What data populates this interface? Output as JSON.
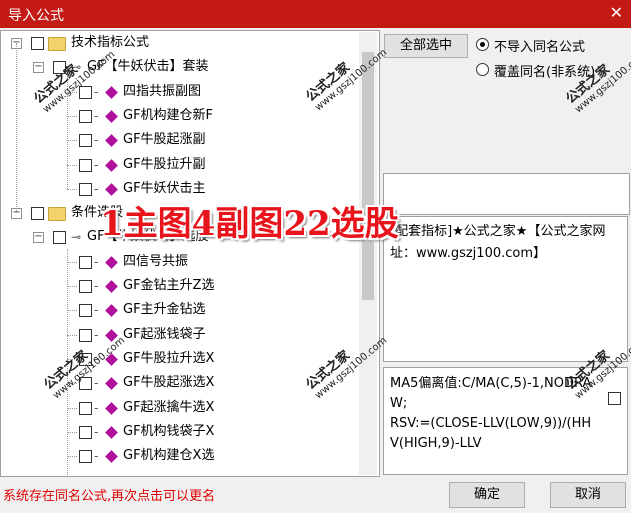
{
  "window": {
    "title": "导入公式",
    "close_glyph": "✕"
  },
  "tree": {
    "nodes": [
      {
        "level": 0,
        "type": "folder",
        "label": "技术指标公式",
        "expand": "−"
      },
      {
        "level": 1,
        "type": "group",
        "label": "GF【牛妖伏击】套装",
        "expand": "−"
      },
      {
        "level": 2,
        "type": "item",
        "label": "四指共振副图"
      },
      {
        "level": 2,
        "type": "item",
        "label": "GF机构建仓新F"
      },
      {
        "level": 2,
        "type": "item",
        "label": "GF牛股起涨副"
      },
      {
        "level": 2,
        "type": "item",
        "label": "GF牛股拉升副"
      },
      {
        "level": 2,
        "type": "item",
        "label": "GF牛妖伏击主"
      },
      {
        "level": 0,
        "type": "folder",
        "label": "条件选股",
        "expand": "−"
      },
      {
        "level": 1,
        "type": "group",
        "label": "GF【牛妖伏击】选股",
        "expand": "−"
      },
      {
        "level": 2,
        "type": "item",
        "label": "四信号共振"
      },
      {
        "level": 2,
        "type": "item",
        "label": "GF金钻主升Z选"
      },
      {
        "level": 2,
        "type": "item",
        "label": "GF主升金钻选"
      },
      {
        "level": 2,
        "type": "item",
        "label": "GF起涨钱袋子"
      },
      {
        "level": 2,
        "type": "item",
        "label": "GF牛股拉升选X"
      },
      {
        "level": 2,
        "type": "item",
        "label": "GF牛股起涨选X"
      },
      {
        "level": 2,
        "type": "item",
        "label": "GF起涨擒牛选X"
      },
      {
        "level": 2,
        "type": "item",
        "label": "GF机构钱袋子X"
      },
      {
        "level": 2,
        "type": "item",
        "label": "GF机构建仓X选"
      }
    ]
  },
  "buttons": {
    "select_all": "全部选中",
    "ok": "确定",
    "cancel": "取消"
  },
  "options": {
    "no_import": "不导入同名公式",
    "overwrite": "覆盖同名(非系统)",
    "selected": "no_import"
  },
  "description": "[配套指标]★公式之家★【公式之家网址：www.gszj100.com】",
  "code_preview": "MA5偏离值:C/MA(C,5)-1,NODRAW;\nRSV:=(CLOSE-LLV(LOW,9))/(HHV(HIGH,9)-LLV",
  "status": "系统存在同名公式,再次点击可以更名",
  "banner": "1主图4副图22选股",
  "watermark": {
    "text": "公式之家",
    "url": "www.gszj100.com"
  }
}
